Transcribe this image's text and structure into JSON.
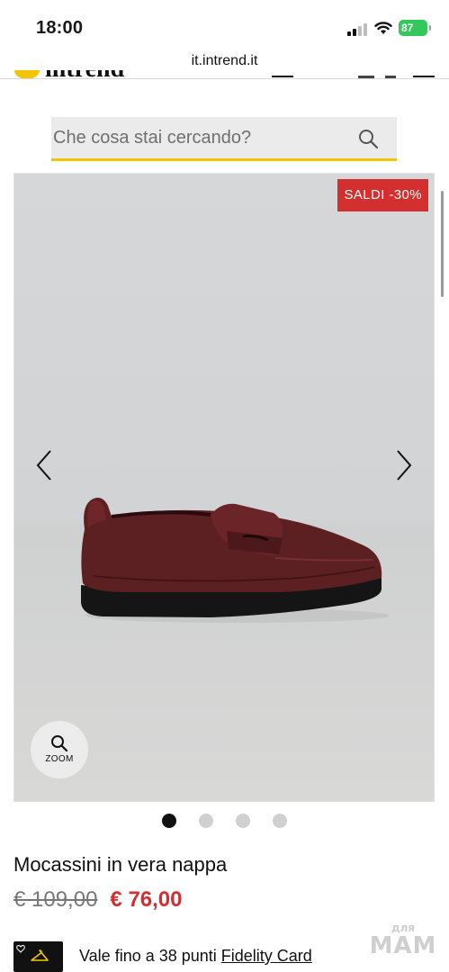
{
  "status_bar": {
    "time": "18:00",
    "battery": "87",
    "url": "it.intrend.it"
  },
  "header": {
    "brand": "intrend",
    "icons": [
      "menu-icon",
      "cart-icon",
      "hamburger-icon"
    ]
  },
  "search": {
    "placeholder": "Che cosa stai cercando?",
    "icon": "search-icon"
  },
  "gallery": {
    "badge": "SALDI  -30%",
    "zoom_label": "ZOOM",
    "image_count": 4,
    "active_index": 0
  },
  "product": {
    "name": "Mocassini in vera nappa",
    "old_price": "€ 109,00",
    "new_price": "€ 76,00"
  },
  "fidelity": {
    "text": "Vale fino a 38 punti ",
    "link": "Fidelity Card"
  },
  "watermark": {
    "small": "для",
    "big": "МАМ"
  },
  "colors": {
    "accent_yellow": "#f5c400",
    "sale_red": "#d32f2f",
    "battery_green": "#34c759"
  }
}
